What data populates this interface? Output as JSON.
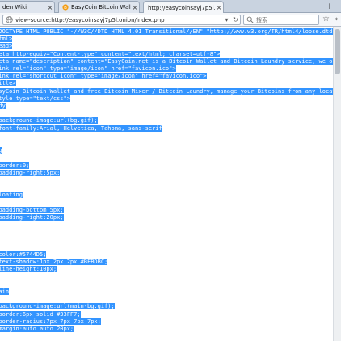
{
  "tabs": [
    {
      "label": "den Wiki",
      "active": false
    },
    {
      "label": "EasyCoin Bitcoin Wallet ...",
      "active": false
    },
    {
      "label": "http://easycoinsayj7p5l.onio...",
      "active": true
    }
  ],
  "address_bar": {
    "url": "view-source:http://easycoinsayj7p5l.onion/index.php"
  },
  "search": {
    "placeholder": "搜索"
  },
  "source_lines": [
    "<!DOCTYPE HTML PUBLIC \"-//W3C//DTD HTML 4.01 Transitional//EN\" \"http://www.w3.org/TR/html4/loose.dtd\">",
    "<html>",
    "<head>",
    "<meta http-equiv=\"Content-type\" content=\"text/html; charset=utf-8\">",
    "<meta name=\"description\" content=\"EasyCoin.net is a Bitcoin Wallet and Bitcoin Laundry service, we offer bitcoin",
    "<link rel=\"icon\" type=\"image/icon\" href=\"favicon.ico\">",
    "<link rel=\"shortcut icon\" type=\"image/icon\" href=\"favicon.ico\">",
    "<title>",
    "EasyCoin Bitcoin Wallet and free Bitcoin Mixer / Bitcoin Laundry, manage your Bitcoins from any location, from",
    "<style type=\"text/css\">",
    "body",
    "{",
    "  background-image:url(bg.gif);",
    "  font-family:Arial, Helvetica, Tahoma, sans-serif",
    "}",
    "",
    "img",
    "{",
    "  border:0;",
    "  padding-right:5px;",
    "}",
    "",
    ".floating",
    "{",
    "  padding-bottom:5px;",
    "  padding-right:20px;",
    "}",
    "",
    "h1",
    "{",
    "  color:#5744D5;",
    "  text-shadow:1px 2px 2px #BFBDBC;",
    "  line-height:10px;",
    "}",
    "",
    "#main",
    "{",
    "  background-image:url(main-bg.gif);",
    "  border:6px solid #33FF7;",
    "  border-radius:7px 7px 7px 7px;",
    "  margin:auto auto 20px;"
  ]
}
